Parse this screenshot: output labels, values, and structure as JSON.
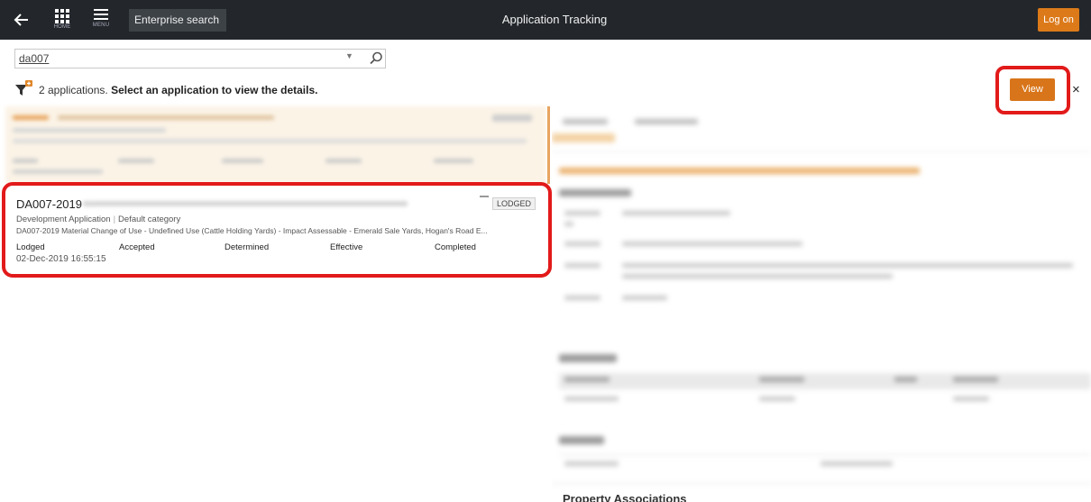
{
  "topbar": {
    "home_label": "HOME",
    "menu_label": "MENU",
    "enterprise_search_label": "Enterprise search",
    "title": "Application Tracking",
    "logon_label": "Log on"
  },
  "search": {
    "value": "da007"
  },
  "results": {
    "count_text": "2 applications.",
    "instruction": "Select an application to view the details."
  },
  "application": {
    "id": "DA007-2019",
    "status": "LODGED",
    "type": "Development Application",
    "category": "Default category",
    "description": "DA007-2019 Material Change of Use - Undefined Use (Cattle Holding Yards) - Impact Assessable - Emerald Sale Yards, Hogan's Road E...",
    "columns": {
      "lodged": "Lodged",
      "accepted": "Accepted",
      "determined": "Determined",
      "effective": "Effective",
      "completed": "Completed"
    },
    "lodged_date": "02-Dec-2019 16:55:15"
  },
  "detail": {
    "view_label": "View",
    "close_label": "×",
    "bottom_heading": "Property Associations"
  },
  "colors": {
    "topbar": "#23272b",
    "accent": "#dc7a1a",
    "highlight": "#e21a1a"
  }
}
